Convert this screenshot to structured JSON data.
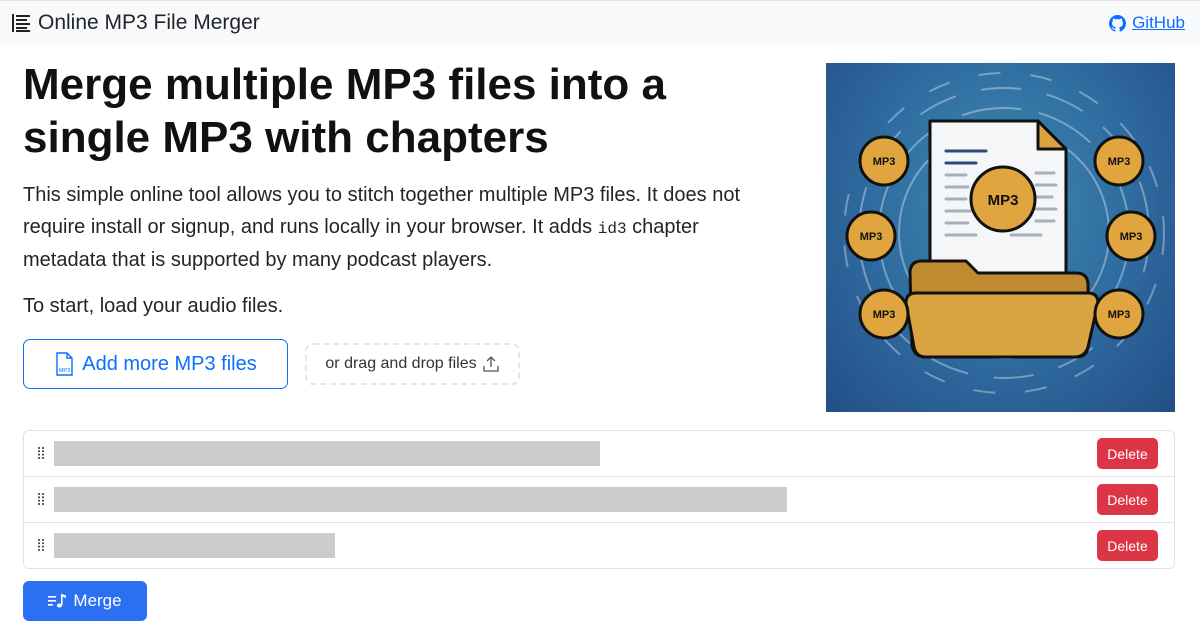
{
  "navbar": {
    "brand_icon": "list-icon",
    "title": "Online MP3 File Merger",
    "github_icon": "github-icon",
    "github_label": "GitHub"
  },
  "main": {
    "heading": "Merge multiple MP3 files into a single MP3 with chapters",
    "intro_before_code": "This simple online tool allows you to stitch together multiple MP3 files. It does not require install or signup, and runs locally in your browser. It adds ",
    "intro_code": "id3",
    "intro_after_code": " chapter metadata that is supported by many podcast players.",
    "start_text": "To start, load your audio files.",
    "add_button_label": "Add more MP3 files",
    "add_button_icon": "mp3-file-icon",
    "add_button_icon_text": "MP3",
    "drop_label": "or drag and drop files",
    "drop_icon": "upload-icon"
  },
  "hero": {
    "center_label": "MP3",
    "badge_label": "MP3",
    "colors": {
      "badge": "#e0a53e",
      "folder": "#d9a441",
      "doc": "#f4f6f8",
      "background": "#2e6a9f"
    }
  },
  "files": [
    {
      "name": "",
      "name_redacted_fraction": 0.48,
      "delete_label": "Delete"
    },
    {
      "name": "",
      "name_redacted_fraction": 0.64,
      "delete_label": "Delete"
    },
    {
      "name": "",
      "name_redacted_fraction": 0.25,
      "delete_label": "Delete"
    }
  ],
  "merge_button": {
    "label": "Merge",
    "icon": "music-list-icon"
  },
  "colors": {
    "primary": "#0d6efd",
    "danger": "#dc3545",
    "navbar_bg": "#f8f9fa"
  }
}
